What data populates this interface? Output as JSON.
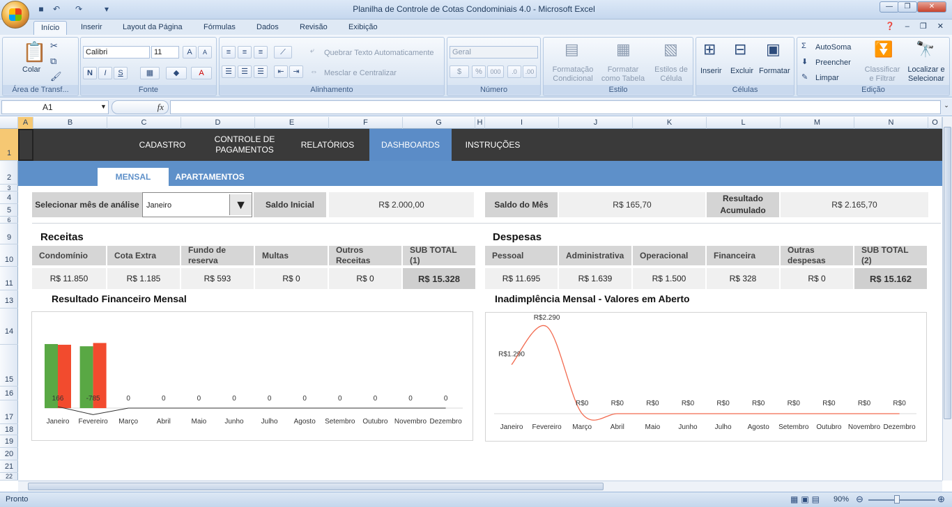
{
  "window": {
    "title": "Planilha de Controle de Cotas Condominiais 4.0  -  Microsoft Excel"
  },
  "qat": {
    "save_icon": "save-icon",
    "undo_icon": "undo-icon",
    "redo_icon": "redo-icon"
  },
  "ribbon_tabs": [
    "Início",
    "Inserir",
    "Layout da Página",
    "Fórmulas",
    "Dados",
    "Revisão",
    "Exibição"
  ],
  "ribbon": {
    "clipboard": {
      "label": "Área de Transf...",
      "paste": "Colar"
    },
    "font": {
      "label": "Fonte",
      "name": "Calibri",
      "size": "11"
    },
    "alignment": {
      "label": "Alinhamento",
      "wrap": "Quebrar Texto Automaticamente",
      "merge": "Mesclar e Centralizar"
    },
    "number": {
      "label": "Número",
      "format": "Geral"
    },
    "styles": {
      "label": "Estilo",
      "conditional": "Formatação\nCondicional",
      "table": "Formatar\ncomo Tabela",
      "cell_styles": "Estilos de\nCélula"
    },
    "cells": {
      "label": "Células",
      "insert": "Inserir",
      "delete": "Excluir",
      "format": "Formatar"
    },
    "editing": {
      "label": "Edição",
      "autosum": "AutoSoma",
      "fill": "Preencher",
      "clear": "Limpar",
      "sort": "Classificar\ne Filtrar",
      "find": "Localizar e\nSelecionar"
    }
  },
  "formula": {
    "cell_ref": "A1",
    "fx": "fx",
    "value": ""
  },
  "columns": [
    "A",
    "B",
    "C",
    "D",
    "E",
    "F",
    "G",
    "H",
    "I",
    "J",
    "K",
    "L",
    "M",
    "N",
    "O"
  ],
  "rows": [
    "1",
    "2",
    "3",
    "4",
    "5",
    "6",
    "9",
    "10",
    "11",
    "13",
    "14",
    "15",
    "16",
    "17",
    "18",
    "19",
    "20",
    "21",
    "22"
  ],
  "nav": {
    "items": [
      "CADASTRO",
      "CONTROLE DE\nPAGAMENTOS",
      "RELATÓRIOS",
      "DASHBOARDS",
      "INSTRUÇÕES"
    ],
    "active": "DASHBOARDS"
  },
  "subtabs": [
    "MENSAL",
    "APARTAMENTOS"
  ],
  "filter": {
    "label": "Selecionar mês de análise",
    "month": "Janeiro",
    "saldo_inicial_label": "Saldo Inicial",
    "saldo_inicial": "R$ 2.000,00",
    "saldo_mes_label": "Saldo do Mês",
    "saldo_mes": "R$ 165,70",
    "resultado_label": "Resultado\nAcumulado",
    "resultado": "R$ 2.165,70"
  },
  "receitas": {
    "title": "Receitas",
    "headers": [
      "Condomínio",
      "Cota Extra",
      "Fundo de\nreserva",
      "Multas",
      "Outros Receitas",
      "SUB TOTAL (1)"
    ],
    "values": [
      "R$ 11.850",
      "R$ 1.185",
      "R$ 593",
      "R$ 0",
      "R$ 0",
      "R$ 15.328"
    ]
  },
  "despesas": {
    "title": "Despesas",
    "headers": [
      "Pessoal",
      "Administrativa",
      "Operacional",
      "Financeira",
      "Outras despesas",
      "SUB TOTAL (2)"
    ],
    "values": [
      "R$ 11.695",
      "R$ 1.639",
      "R$ 1.500",
      "R$ 328",
      "R$ 0",
      "R$ 15.162"
    ]
  },
  "chart_data": [
    {
      "type": "bar",
      "title": "Resultado Financeiro Mensal",
      "categories": [
        "Janeiro",
        "Fevereiro",
        "Março",
        "Abril",
        "Maio",
        "Junho",
        "Julho",
        "Agosto",
        "Setembro",
        "Outubro",
        "Novembro",
        "Dezembro"
      ],
      "series": [
        {
          "values": [
            15328,
            14800,
            0,
            0,
            0,
            0,
            0,
            0,
            0,
            0,
            0,
            0
          ]
        },
        {
          "values": [
            15162,
            15585,
            0,
            0,
            0,
            0,
            0,
            0,
            0,
            0,
            0,
            0
          ]
        }
      ],
      "line_values": [
        166,
        -785,
        0,
        0,
        0,
        0,
        0,
        0,
        0,
        0,
        0,
        0
      ],
      "data_labels": [
        "166",
        "-785",
        "0",
        "0",
        "0",
        "0",
        "0",
        "0",
        "0",
        "0",
        "0",
        "0"
      ]
    },
    {
      "type": "line",
      "title": "Inadimplência Mensal - Valores em Aberto",
      "categories": [
        "Janeiro",
        "Fevereiro",
        "Março",
        "Abril",
        "Maio",
        "Junho",
        "Julho",
        "Agosto",
        "Setembro",
        "Outubro",
        "Novembro",
        "Dezembro"
      ],
      "values": [
        1290,
        2290,
        0,
        0,
        0,
        0,
        0,
        0,
        0,
        0,
        0,
        0
      ],
      "data_labels": [
        "R$1.290",
        "R$2.290",
        "R$0",
        "R$0",
        "R$0",
        "R$0",
        "R$0",
        "R$0",
        "R$0",
        "R$0",
        "R$0",
        "R$0"
      ]
    }
  ],
  "colors": {
    "green": "#59a844",
    "red": "#f24b2e",
    "nav_dark": "#3a3a3a",
    "nav_blue": "#5e90c9",
    "line": "#f26a4f"
  },
  "status": {
    "text": "Pronto",
    "zoom": "90%"
  }
}
